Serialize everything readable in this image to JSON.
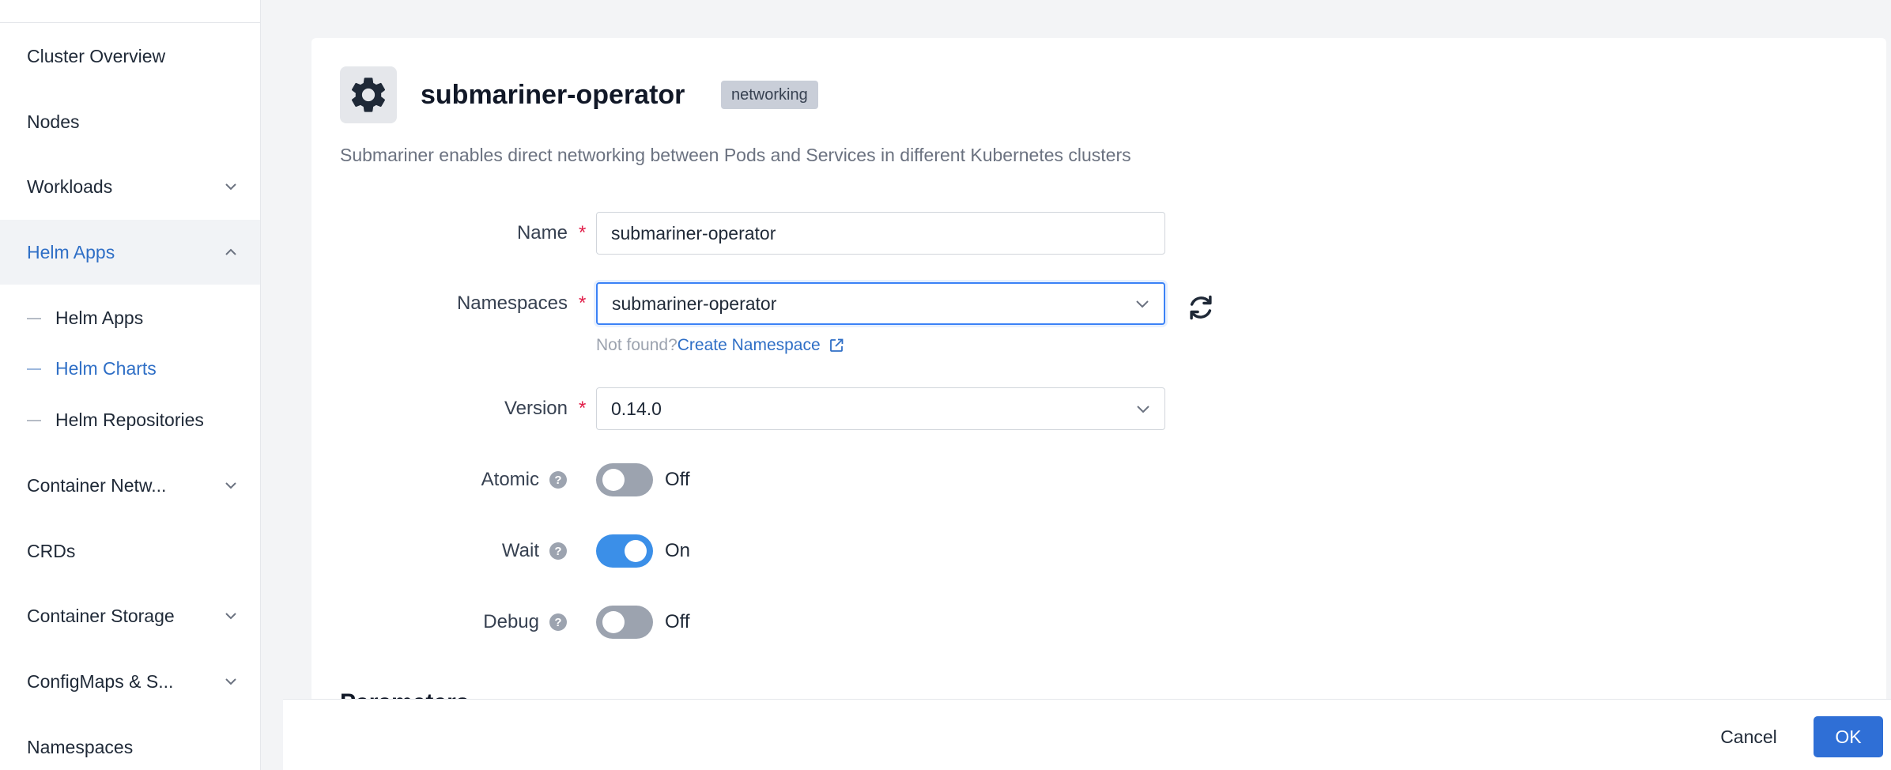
{
  "sidebar": {
    "items": [
      {
        "label": "Cluster Overview",
        "has_chevron": false
      },
      {
        "label": "Nodes",
        "has_chevron": false
      },
      {
        "label": "Workloads",
        "has_chevron": true
      },
      {
        "label": "Helm Apps",
        "has_chevron": true,
        "expanded": true
      },
      {
        "label": "Container Netw...",
        "has_chevron": true
      },
      {
        "label": "CRDs",
        "has_chevron": false
      },
      {
        "label": "Container Storage",
        "has_chevron": true
      },
      {
        "label": "ConfigMaps & S...",
        "has_chevron": true
      },
      {
        "label": "Namespaces",
        "has_chevron": false
      }
    ],
    "sub_items": [
      {
        "label": "Helm Apps",
        "active": false
      },
      {
        "label": "Helm Charts",
        "active": true
      },
      {
        "label": "Helm Repositories",
        "active": false
      }
    ]
  },
  "app": {
    "icon": "gear-icon",
    "title": "submariner-operator",
    "tag": "networking",
    "description": "Submariner enables direct networking between Pods and Services in different Kubernetes clusters"
  },
  "form": {
    "name": {
      "label": "Name",
      "value": "submariner-operator"
    },
    "namespaces": {
      "label": "Namespaces",
      "value": "submariner-operator",
      "hint": "Not found?",
      "link": "Create Namespace"
    },
    "version": {
      "label": "Version",
      "value": "0.14.0"
    },
    "atomic": {
      "label": "Atomic",
      "state": "Off",
      "enabled": false
    },
    "wait": {
      "label": "Wait",
      "state": "On",
      "enabled": true
    },
    "debug": {
      "label": "Debug",
      "state": "Off",
      "enabled": false
    },
    "next_section": "Parameters"
  },
  "footer": {
    "cancel": "Cancel",
    "ok": "OK"
  },
  "colors": {
    "accent": "#2f6fd6",
    "link": "#2f6fc6",
    "toggle_on": "#3b8fe8",
    "required": "#e11d48"
  }
}
